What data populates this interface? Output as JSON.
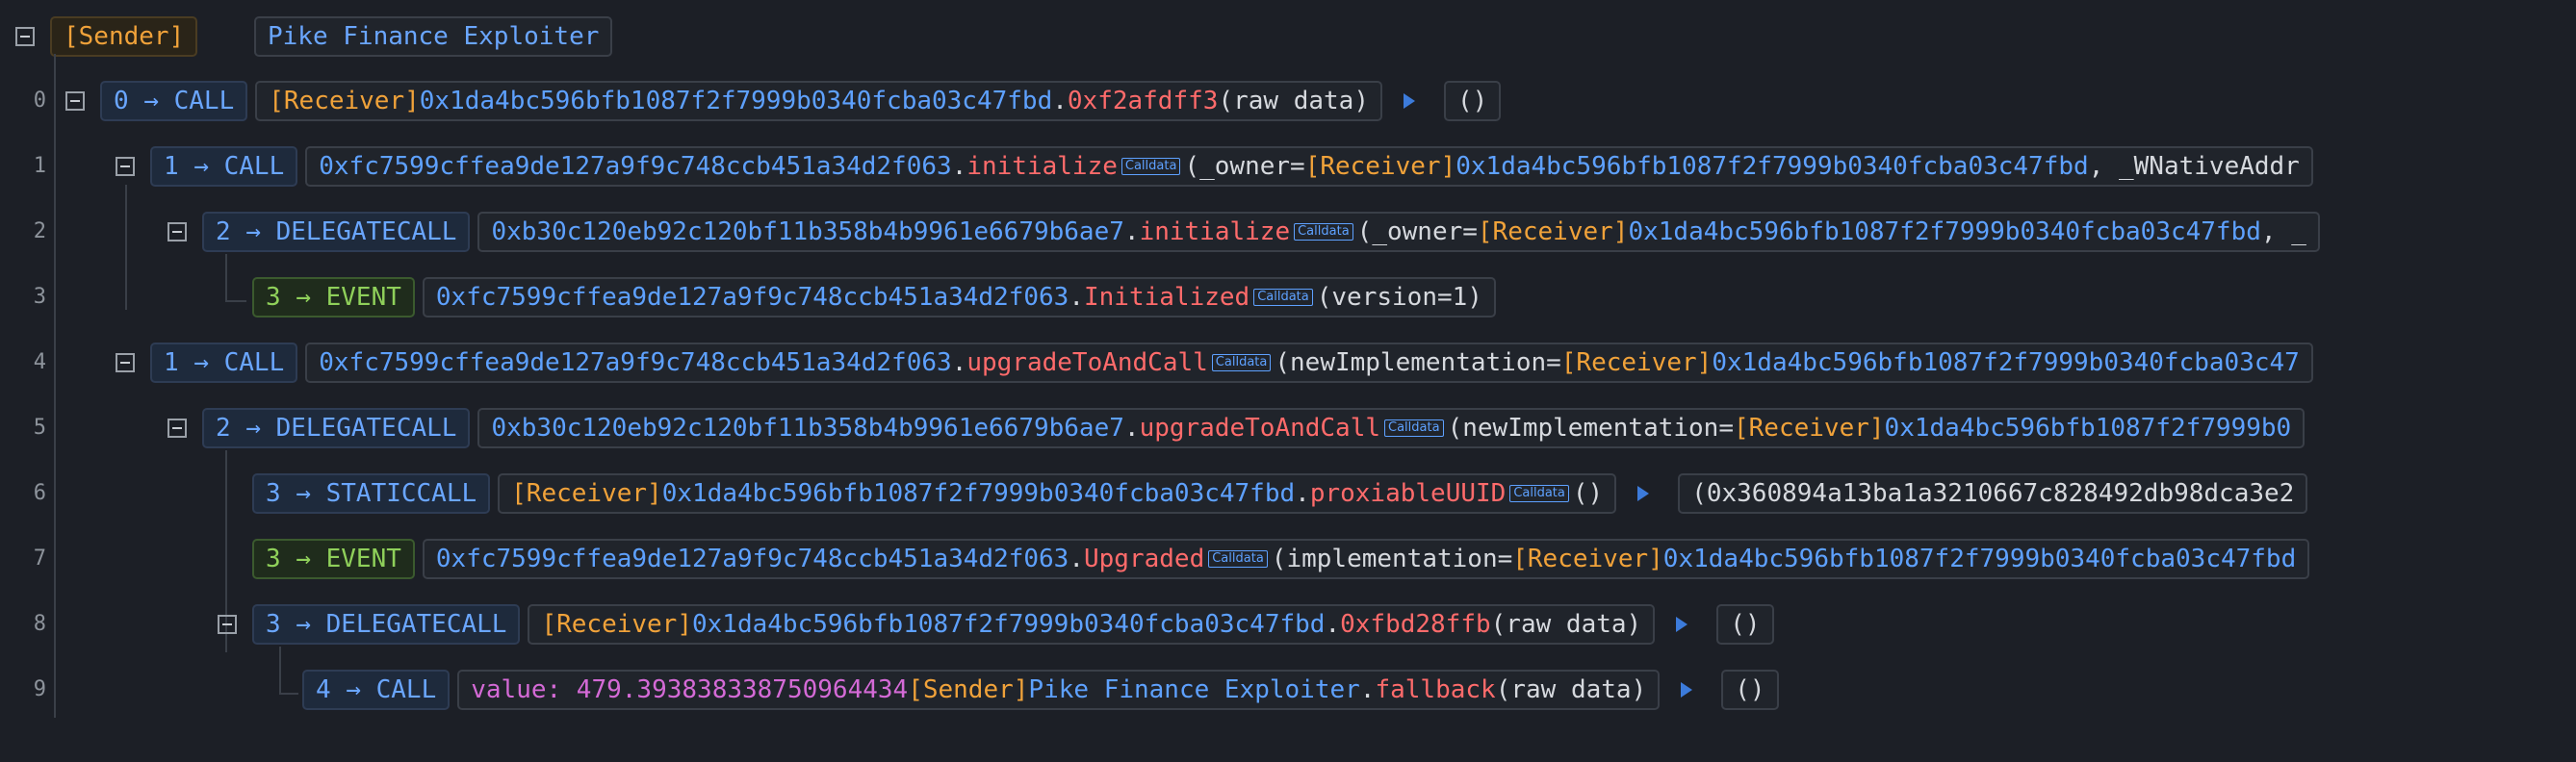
{
  "header": {
    "sender_tag": "[Sender]",
    "sender_name": "Pike Finance Exploiter"
  },
  "rows": [
    {
      "num": "0",
      "type": "0 → CALL",
      "parts": [
        [
          "sender",
          "[Receiver] "
        ],
        [
          "addr",
          "0x1da4bc596bfb1087f2f7999b0340fcba03c47fbd"
        ],
        [
          "plain",
          "."
        ],
        [
          "fn",
          "0xf2afdff3"
        ],
        [
          "plain",
          "(raw data)"
        ]
      ],
      "result": "()"
    },
    {
      "num": "1",
      "type": "1 → CALL",
      "parts": [
        [
          "addr",
          "0xfc7599cffea9de127a9f9c748ccb451a34d2f063"
        ],
        [
          "plain",
          "."
        ],
        [
          "fn",
          "initialize"
        ],
        [
          "badge",
          "Calldata"
        ],
        [
          "plain",
          "(_owner="
        ],
        [
          "sender",
          "[Receiver]"
        ],
        [
          "addr",
          "0x1da4bc596bfb1087f2f7999b0340fcba03c47fbd"
        ],
        [
          "plain",
          ", _WNativeAddr"
        ]
      ]
    },
    {
      "num": "2",
      "type": "2 → DELEGATECALL",
      "parts": [
        [
          "addr",
          "0xb30c120eb92c120bf11b358b4b9961e6679b6ae7"
        ],
        [
          "plain",
          "."
        ],
        [
          "fn",
          "initialize"
        ],
        [
          "badge",
          "Calldata"
        ],
        [
          "plain",
          "(_owner="
        ],
        [
          "sender",
          "[Receiver]"
        ],
        [
          "addr",
          "0x1da4bc596bfb1087f2f7999b0340fcba03c47fbd"
        ],
        [
          "plain",
          ", _"
        ]
      ]
    },
    {
      "num": "3",
      "type": "3 → EVENT",
      "parts": [
        [
          "addr",
          "0xfc7599cffea9de127a9f9c748ccb451a34d2f063"
        ],
        [
          "plain",
          "."
        ],
        [
          "fn",
          "Initialized"
        ],
        [
          "badge",
          "Calldata"
        ],
        [
          "plain",
          "(version=1)"
        ]
      ]
    },
    {
      "num": "4",
      "type": "1 → CALL",
      "parts": [
        [
          "addr",
          "0xfc7599cffea9de127a9f9c748ccb451a34d2f063"
        ],
        [
          "plain",
          "."
        ],
        [
          "fn",
          "upgradeToAndCall"
        ],
        [
          "badge",
          "Calldata"
        ],
        [
          "plain",
          "(newImplementation="
        ],
        [
          "sender",
          "[Receiver]"
        ],
        [
          "addr",
          "0x1da4bc596bfb1087f2f7999b0340fcba03c47"
        ]
      ]
    },
    {
      "num": "5",
      "type": "2 → DELEGATECALL",
      "parts": [
        [
          "addr",
          "0xb30c120eb92c120bf11b358b4b9961e6679b6ae7"
        ],
        [
          "plain",
          "."
        ],
        [
          "fn",
          "upgradeToAndCall"
        ],
        [
          "badge",
          "Calldata"
        ],
        [
          "plain",
          "(newImplementation="
        ],
        [
          "sender",
          "[Receiver]"
        ],
        [
          "addr",
          "0x1da4bc596bfb1087f2f7999b0"
        ]
      ]
    },
    {
      "num": "6",
      "type": "3 → STATICCALL",
      "parts": [
        [
          "sender",
          "[Receiver] "
        ],
        [
          "addr",
          "0x1da4bc596bfb1087f2f7999b0340fcba03c47fbd"
        ],
        [
          "plain",
          "."
        ],
        [
          "fn",
          "proxiableUUID"
        ],
        [
          "badge",
          "Calldata"
        ],
        [
          "plain",
          "()"
        ]
      ],
      "result": "(0x360894a13ba1a3210667c828492db98dca3e2"
    },
    {
      "num": "7",
      "type": "3 → EVENT",
      "parts": [
        [
          "addr",
          "0xfc7599cffea9de127a9f9c748ccb451a34d2f063"
        ],
        [
          "plain",
          "."
        ],
        [
          "fn",
          "Upgraded"
        ],
        [
          "badge",
          "Calldata"
        ],
        [
          "plain",
          "(implementation="
        ],
        [
          "sender",
          "[Receiver]"
        ],
        [
          "addr",
          "0x1da4bc596bfb1087f2f7999b0340fcba03c47fbd"
        ]
      ]
    },
    {
      "num": "8",
      "type": "3 → DELEGATECALL",
      "parts": [
        [
          "sender",
          "[Receiver] "
        ],
        [
          "addr",
          "0x1da4bc596bfb1087f2f7999b0340fcba03c47fbd"
        ],
        [
          "plain",
          "."
        ],
        [
          "fn",
          "0xfbd28ffb"
        ],
        [
          "plain",
          "(raw data)"
        ]
      ],
      "result": "()"
    },
    {
      "num": "9",
      "type": "4 → CALL",
      "parts": [
        [
          "val",
          "value: 479.393838338750964434 "
        ],
        [
          "sender",
          "[Sender] "
        ],
        [
          "addr",
          "Pike Finance Exploiter"
        ],
        [
          "plain",
          "."
        ],
        [
          "fn",
          "fallback"
        ],
        [
          "plain",
          "(raw data)"
        ]
      ],
      "result": "()"
    }
  ]
}
